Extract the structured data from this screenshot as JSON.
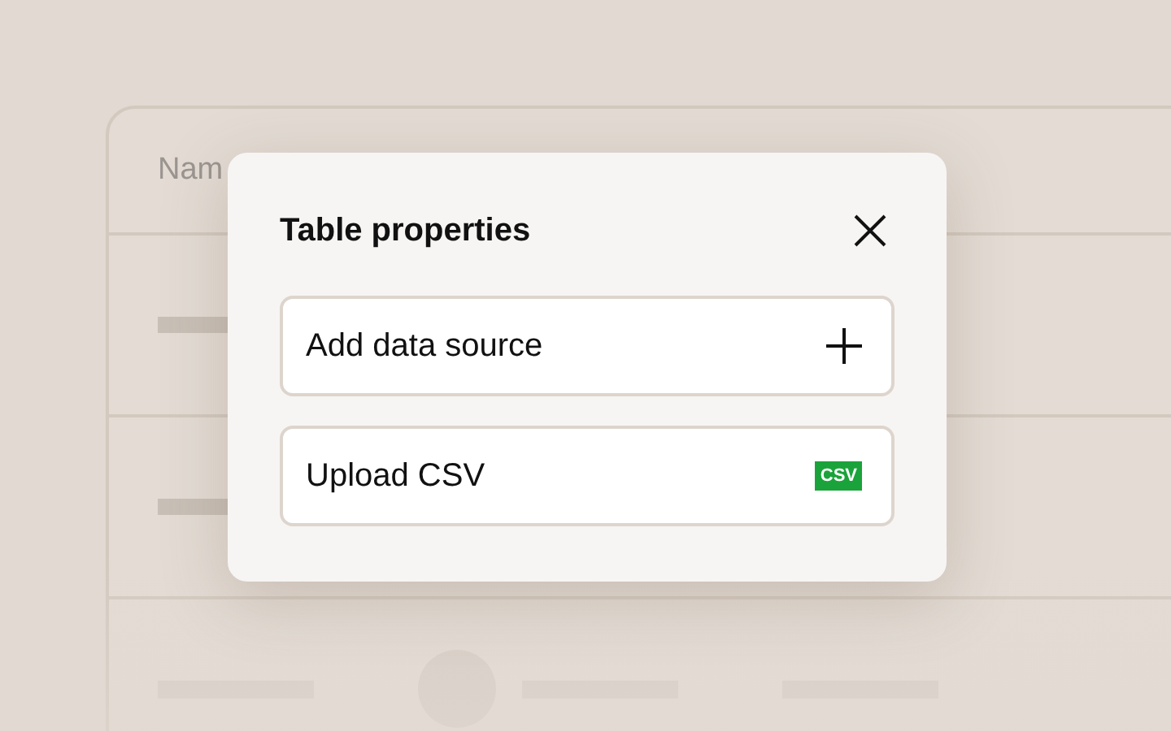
{
  "table": {
    "columns": [
      "Nam"
    ]
  },
  "dialog": {
    "title": "Table properties",
    "items": [
      {
        "kind": "add",
        "label": "Add data source"
      },
      {
        "kind": "csv",
        "label": "Upload CSV",
        "badge": "CSV"
      }
    ]
  }
}
